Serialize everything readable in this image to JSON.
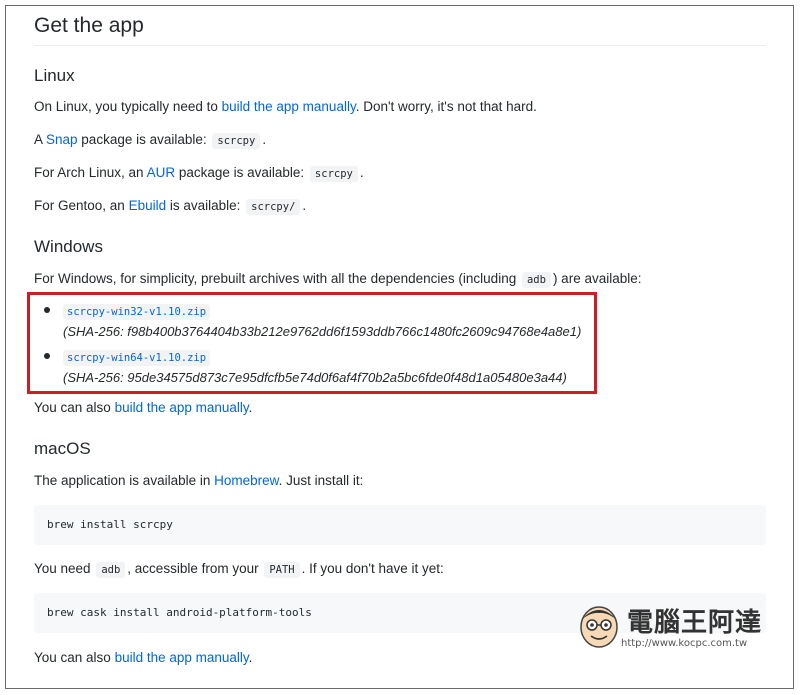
{
  "section": {
    "title": "Get the app"
  },
  "linux": {
    "heading": "Linux",
    "p1": {
      "pre": "On Linux, you typically need to ",
      "link": "build the app manually",
      "post": ". Don't worry, it's not that hard."
    },
    "p2": {
      "pre": "A ",
      "link": "Snap",
      "mid": " package is available: ",
      "code": "scrcpy",
      "post": "."
    },
    "p3": {
      "pre": "For Arch Linux, an ",
      "link": "AUR",
      "mid": " package is available: ",
      "code": "scrcpy",
      "post": "."
    },
    "p4": {
      "pre": "For Gentoo, an ",
      "link": "Ebuild",
      "mid": " is available: ",
      "code": "scrcpy/",
      "post": "."
    }
  },
  "windows": {
    "heading": "Windows",
    "intro": {
      "pre": "For Windows, for simplicity, prebuilt archives with all the dependencies (including ",
      "code": "adb",
      "post": ") are available:"
    },
    "downloads": [
      {
        "file": "scrcpy-win32-v1.10.zip",
        "sha": "(SHA-256: f98b400b3764404b33b212e9762dd6f1593ddb766c1480fc2609c94768e4a8e1)"
      },
      {
        "file": "scrcpy-win64-v1.10.zip",
        "sha": "(SHA-256: 95de34575d873c7e95dfcfb5e74d0f6af4f70b2a5bc6fde0f48d1a05480e3a44)"
      }
    ],
    "also": {
      "pre": "You can also ",
      "link": "build the app manually",
      "post": "."
    }
  },
  "macos": {
    "heading": "macOS",
    "intro": {
      "pre": "The application is available in ",
      "link": "Homebrew",
      "post": ". Just install it:"
    },
    "cmd1": "brew install scrcpy",
    "need": {
      "pre": "You need ",
      "code1": "adb",
      "mid": ", accessible from your ",
      "code2": "PATH",
      "post": ". If you don't have it yet:"
    },
    "cmd2": "brew cask install android-platform-tools",
    "also": {
      "pre": "You can also ",
      "link": "build the app manually",
      "post": "."
    }
  },
  "watermark": {
    "title": "電腦王阿達",
    "url": "http://www.kocpc.com.tw"
  },
  "colors": {
    "link": "#0366d6",
    "highlight": "#cc1f25",
    "text": "#24292e"
  },
  "icons": {
    "watermark_mascot": "cartoon-face-icon"
  }
}
